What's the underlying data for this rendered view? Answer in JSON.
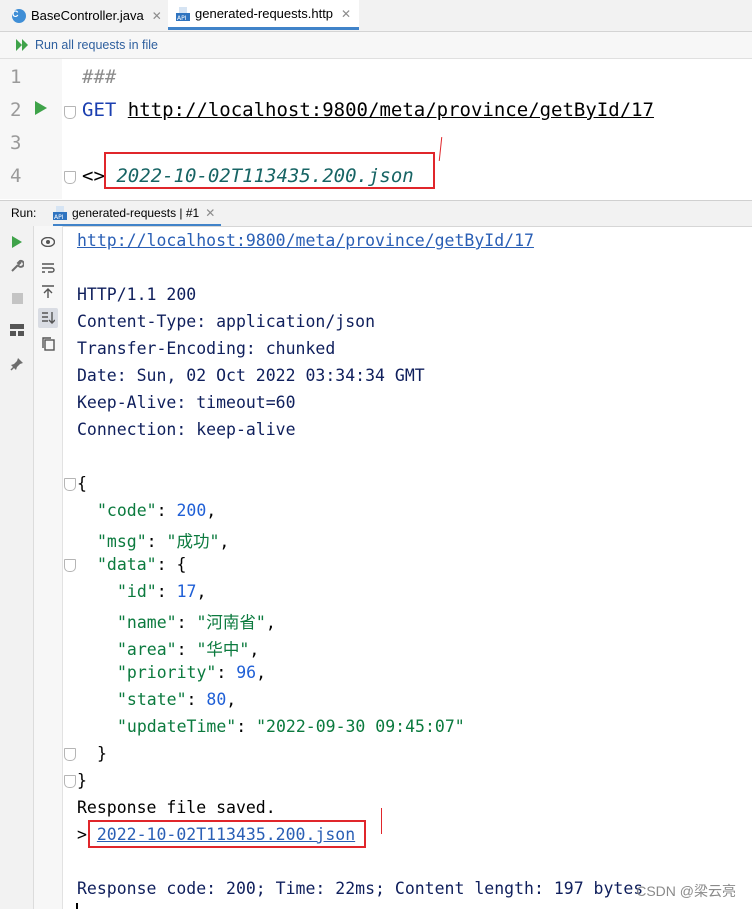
{
  "tabs": [
    {
      "label": "BaseController.java",
      "icon": "java-class-icon"
    },
    {
      "label": "generated-requests.http",
      "icon": "api-file-icon"
    }
  ],
  "toolbar": {
    "run_all_label": "Run all requests in file"
  },
  "editor": {
    "line_numbers": [
      "1",
      "2",
      "3",
      "4"
    ],
    "separator": "###",
    "method": "GET",
    "url": "http://localhost:9800/meta/province/getById/17",
    "response_ref_prefix": "<> ",
    "response_ref_file": "2022-10-02T113435.200.json"
  },
  "run_panel": {
    "run_label": "Run:",
    "tab_label": "generated-requests",
    "tab_suffix": "#1"
  },
  "output": {
    "request_url": "http://localhost:9800/meta/province/getById/17",
    "status_line": "HTTP/1.1 200",
    "headers": [
      "Content-Type: application/json",
      "Transfer-Encoding: chunked",
      "Date: Sun, 02 Oct 2022 03:34:34 GMT",
      "Keep-Alive: timeout=60",
      "Connection: keep-alive"
    ],
    "json": {
      "code_key": "\"code\"",
      "code_val": "200",
      "msg_key": "\"msg\"",
      "msg_val": "\"成功\"",
      "data_key": "\"data\"",
      "id_key": "\"id\"",
      "id_val": "17",
      "name_key": "\"name\"",
      "name_val": "\"河南省\"",
      "area_key": "\"area\"",
      "area_val": "\"华中\"",
      "priority_key": "\"priority\"",
      "priority_val": "96",
      "state_key": "\"state\"",
      "state_val": "80",
      "updateTime_key": "\"updateTime\"",
      "updateTime_val": "\"2022-09-30 09:45:07\""
    },
    "saved_msg": "Response file saved.",
    "saved_prefix": "> ",
    "saved_file": "2022-10-02T113435.200.json",
    "summary": "Response code: 200; Time: 22ms; Content length: 197 bytes"
  },
  "watermark": "CSDN @梁云亮",
  "colors": {
    "highlight_box": "#e0262b",
    "run_green": "#3fa34a",
    "link_blue": "#2a5fb5"
  }
}
